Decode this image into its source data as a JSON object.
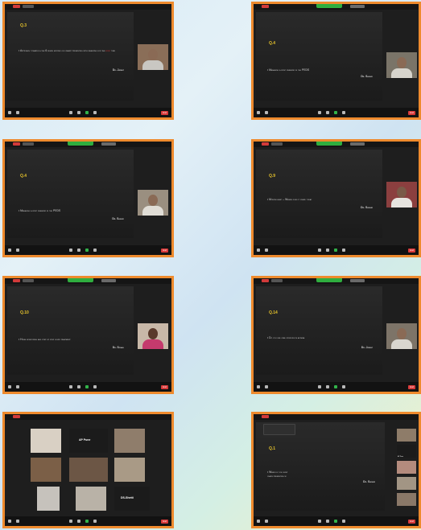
{
  "slides": [
    {
      "q": "Q.3",
      "bullet": "Approach towards a the 6 seven months old infant presenting with wheezing for the",
      "highlight": "first",
      "bullet_tail": "time",
      "author": "Dr. Jayant",
      "participant": ""
    },
    {
      "q": "Q.4",
      "bullet": "Managing a first wheezer in the PEDS",
      "highlight": "",
      "bullet_tail": "",
      "author": "Dr. Sanjay",
      "participant": ""
    },
    {
      "q": "Q.4",
      "bullet": "Managing a first wheezer in the PEDS",
      "highlight": "",
      "bullet_tail": "",
      "author": "Dr. Sanjay",
      "participant": ""
    },
    {
      "q": "Q.9",
      "bullet": "Montelukast – Where does it stand today",
      "highlight": "",
      "bullet_tail": "",
      "author": "Dr. Shishir",
      "participant": ""
    },
    {
      "q": "Q.10",
      "bullet": "Home monitoring and step up step down treatment",
      "highlight": "",
      "bullet_tail": "",
      "author": "Dr. Sonali",
      "participant": ""
    },
    {
      "q": "Q.14",
      "bullet": "Do you use oral steroids in asthma",
      "highlight": "",
      "bullet_tail": "",
      "author": "Dr. Jayant",
      "participant": ""
    }
  ],
  "gallery": {
    "label_top": "AP Pune",
    "label_bottom": "DS-Shetti"
  },
  "last_slide": {
    "q": "Q.1",
    "bullet_start": "When do you susp",
    "bullet_line2": "years presenting w",
    "author": "Dr. Shishir",
    "thumb_label": "AP Pune"
  },
  "toolbar": {
    "end_label": "End"
  }
}
